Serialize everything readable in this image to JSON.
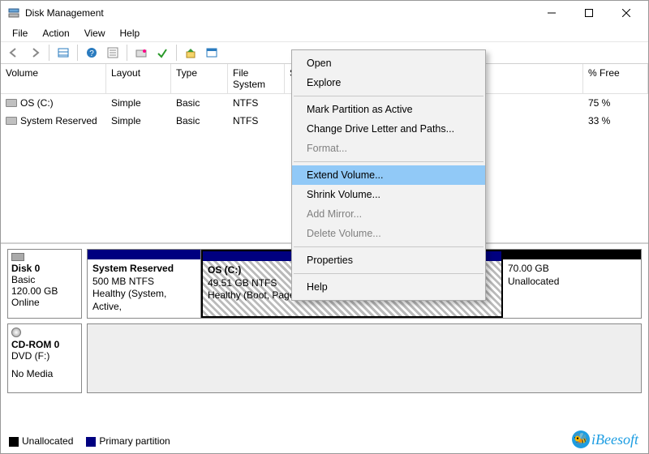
{
  "window": {
    "title": "Disk Management"
  },
  "menubar": {
    "file": "File",
    "action": "Action",
    "view": "View",
    "help": "Help"
  },
  "columns": {
    "volume": "Volume",
    "layout": "Layout",
    "type": "Type",
    "fs": "File System",
    "status": "Status",
    "free": "% Free"
  },
  "volumes": [
    {
      "name": "OS (C:)",
      "layout": "Simple",
      "type": "Basic",
      "fs": "NTFS",
      "free": "75 %"
    },
    {
      "name": "System Reserved",
      "layout": "Simple",
      "type": "Basic",
      "fs": "NTFS",
      "free": "33 %"
    }
  ],
  "disk0": {
    "label": "Disk 0",
    "kind": "Basic",
    "size": "120.00 GB",
    "state": "Online",
    "parts": [
      {
        "title": "System Reserved",
        "size": "500 MB NTFS",
        "status": "Healthy (System, Active,"
      },
      {
        "title": "OS  (C:)",
        "size": "49.51 GB NTFS",
        "status": "Healthy (Boot, Page File, Crash Dump, Primary"
      },
      {
        "title": "",
        "size": "70.00 GB",
        "status": "Unallocated"
      }
    ]
  },
  "cdrom": {
    "label": "CD-ROM 0",
    "drive": "DVD (F:)",
    "state": "No Media"
  },
  "legend": {
    "unalloc": "Unallocated",
    "primary": "Primary partition"
  },
  "ctx": {
    "open": "Open",
    "explore": "Explore",
    "mark": "Mark Partition as Active",
    "change": "Change Drive Letter and Paths...",
    "format": "Format...",
    "extend": "Extend Volume...",
    "shrink": "Shrink Volume...",
    "mirror": "Add Mirror...",
    "delete": "Delete Volume...",
    "props": "Properties",
    "help": "Help"
  },
  "brand": "iBeesoft"
}
